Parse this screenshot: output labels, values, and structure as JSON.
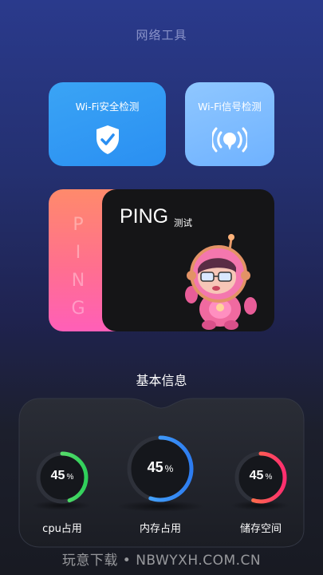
{
  "header": {
    "title": "网络工具"
  },
  "tools": {
    "wifi_security": {
      "label": "Wi-Fi安全检测",
      "color": "#2a8ff2"
    },
    "wifi_signal": {
      "label": "Wi-Fi信号检测",
      "color": "#6fb2ff"
    }
  },
  "ping_card": {
    "title": "PING",
    "subtitle": "测试",
    "vertical_text": [
      "P",
      "I",
      "N",
      "G"
    ]
  },
  "basic_info": {
    "title": "基本信息",
    "gauges": [
      {
        "key": "cpu",
        "value": "45",
        "unit": "%",
        "label": "cpu占用",
        "fraction": 0.45,
        "colors": [
          "#7ee87a",
          "#2ecf5a"
        ]
      },
      {
        "key": "memory",
        "value": "45",
        "unit": "%",
        "label": "内存占用",
        "fraction": 0.55,
        "colors": [
          "#4fb3ff",
          "#2d7cf0"
        ]
      },
      {
        "key": "storage",
        "value": "45",
        "unit": "%",
        "label": "储存空间",
        "fraction": 0.55,
        "colors": [
          "#ff8a3a",
          "#ff2d6f"
        ]
      }
    ]
  },
  "watermark": {
    "text": "玩意下载 • NBWYXH.COM.CN"
  }
}
